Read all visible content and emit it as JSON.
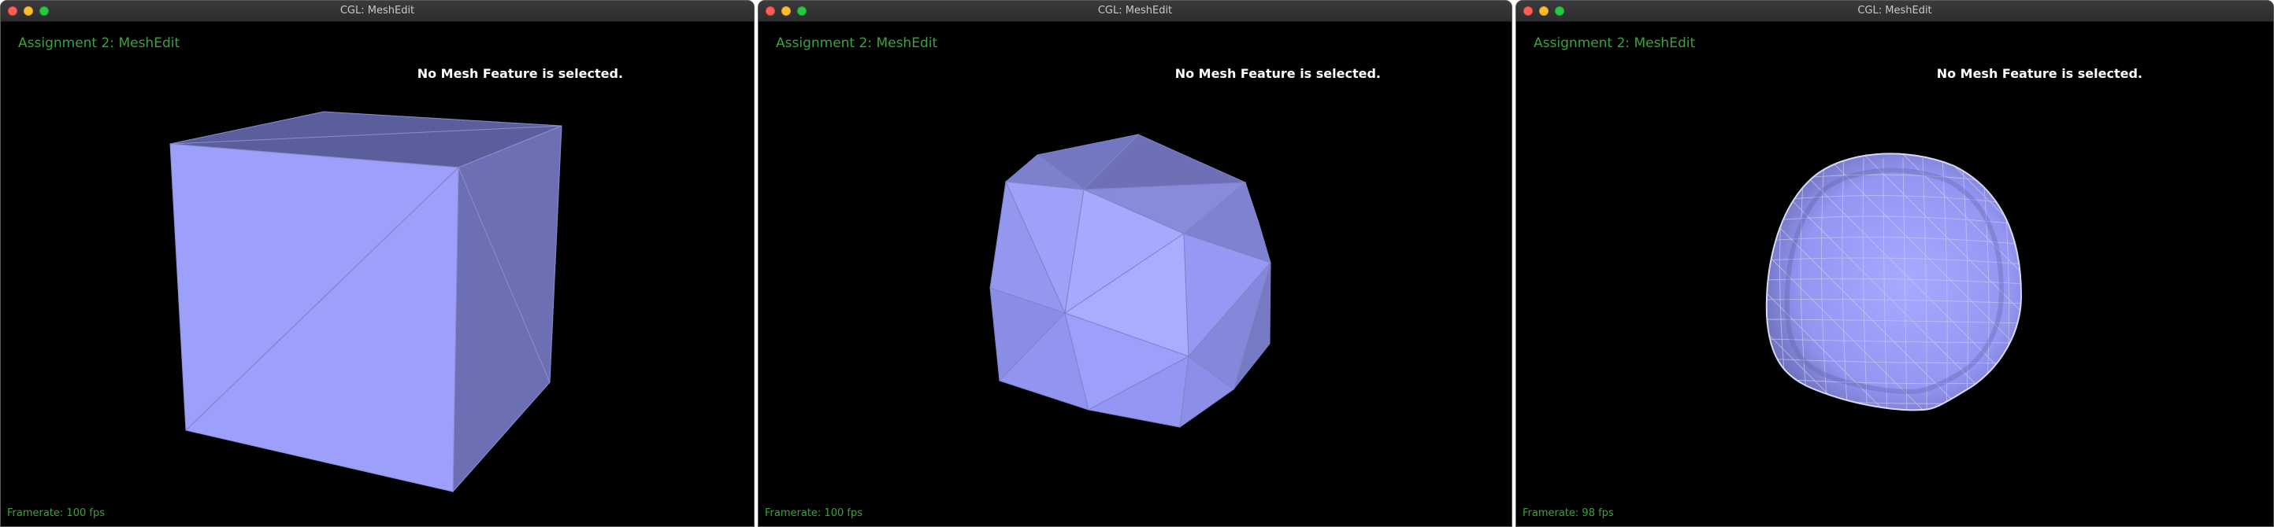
{
  "windows": [
    {
      "title": "CGL: MeshEdit",
      "hud_title": "Assignment 2: MeshEdit",
      "status": "No Mesh Feature is selected.",
      "framerate": "Framerate: 100 fps",
      "mesh": "cube"
    },
    {
      "title": "CGL: MeshEdit",
      "hud_title": "Assignment 2: MeshEdit",
      "status": "No Mesh Feature is selected.",
      "framerate": "Framerate: 100 fps",
      "mesh": "icosahedral-blob"
    },
    {
      "title": "CGL: MeshEdit",
      "hud_title": "Assignment 2: MeshEdit",
      "status": "No Mesh Feature is selected.",
      "framerate": "Framerate: 98 fps",
      "mesh": "subdivided-rounded-cube"
    }
  ],
  "colors": {
    "background": "#000000",
    "hud_green": "#3ba33b",
    "mesh_fill": "#8f93f5",
    "mesh_edge": "#6e72b8"
  }
}
